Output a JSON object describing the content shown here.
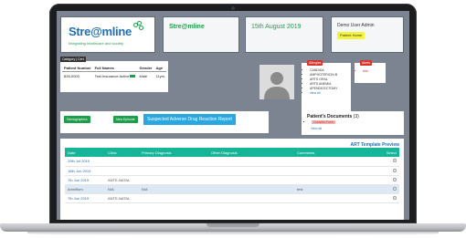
{
  "header": {
    "logo_text": "Stre@mline",
    "logo_tagline": "Integrating healthcare and society",
    "brand": "Stre@mline",
    "date": "15th August 2019",
    "user_name": "Demo User Admin",
    "user_button": "Patient Home"
  },
  "patient": {
    "category": "Category | Cert",
    "columns": [
      "Patient Number",
      "Full Names",
      "Gender",
      "Age"
    ],
    "row": {
      "number": "826-0003",
      "name": "Test Insurance Active",
      "gender": "Male",
      "age": "11yrs"
    }
  },
  "allergies": {
    "label": "Allergies",
    "items": [
      "CANDIDA",
      "AMPHOTERICIN B",
      "ARTS ORAL",
      "ARTS ANEMIA",
      "APENDICECTOMY"
    ],
    "view_all": "view all"
  },
  "alerts": {
    "label": "Alerts",
    "items": [
      "test"
    ]
  },
  "actions": {
    "btn1": "Demographics",
    "btn2": "New Episode",
    "adr": "Suspected Adverse Drug Reaction Report"
  },
  "documents": {
    "title": "Patient's Documents",
    "count": "(3)",
    "item": "Consent Form",
    "view_all": "View all"
  },
  "records": {
    "title": "ART Template Preview",
    "columns": [
      "Date",
      "Clinic",
      "Primary Diagnosis",
      "Other Diagnosis",
      "Comments",
      "Select"
    ],
    "rows": [
      {
        "date": "19th Jul 2019",
        "clinic": "",
        "primary": "",
        "other": "",
        "comments": ""
      },
      {
        "date": "18th Jun 2019",
        "clinic": "",
        "primary": "",
        "other": "",
        "comments": ""
      },
      {
        "date": "7th Jun 2019",
        "clinic": "ANTE-NATAL",
        "primary": "",
        "other": "",
        "comments": ""
      },
      {
        "date": "Amniflum",
        "clinic": "N/A",
        "primary": "N/A",
        "other": "",
        "comments": "test"
      },
      {
        "date": "7th Jun 2019",
        "clinic": "ANTE-NATAL",
        "primary": "",
        "other": "",
        "comments": ""
      }
    ]
  },
  "colors": {
    "accent_green": "#1e9e4c",
    "table_header": "#16b59a",
    "alert_red": "#d9342b",
    "link_blue": "#1f6fb5"
  }
}
